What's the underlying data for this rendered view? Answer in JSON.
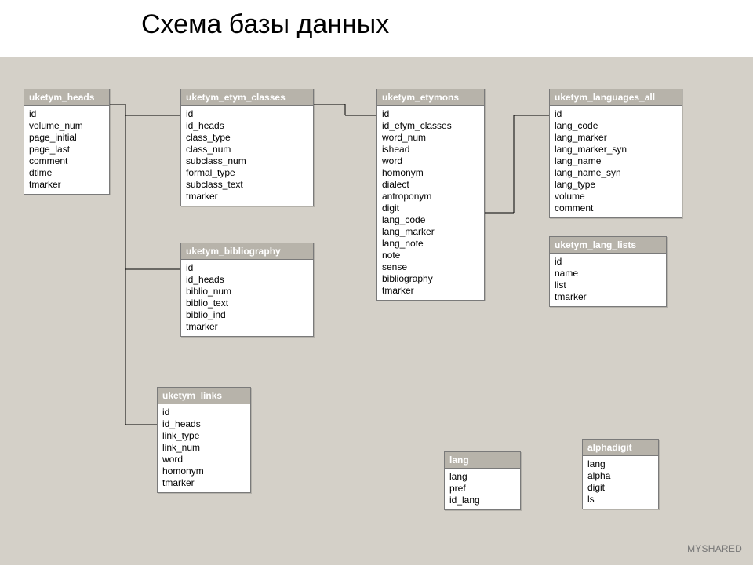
{
  "title": "Схема базы данных",
  "watermark": "MYSHARED",
  "tables": {
    "heads": {
      "name": "uketym_heads",
      "fields": [
        "id",
        "volume_num",
        "page_initial",
        "page_last",
        "comment",
        "dtime",
        "tmarker"
      ]
    },
    "etym_classes": {
      "name": "uketym_etym_classes",
      "fields": [
        "id",
        "id_heads",
        "class_type",
        "class_num",
        "subclass_num",
        "formal_type",
        "subclass_text",
        "tmarker"
      ]
    },
    "bibliography": {
      "name": "uketym_bibliography",
      "fields": [
        "id",
        "id_heads",
        "biblio_num",
        "biblio_text",
        "biblio_ind",
        "tmarker"
      ]
    },
    "links": {
      "name": "uketym_links",
      "fields": [
        "id",
        "id_heads",
        "link_type",
        "link_num",
        "word",
        "homonym",
        "tmarker"
      ]
    },
    "etymons": {
      "name": "uketym_etymons",
      "fields": [
        "id",
        "id_etym_classes",
        "word_num",
        "ishead",
        "word",
        "homonym",
        "dialect",
        "antroponym",
        "digit",
        "lang_code",
        "lang_marker",
        "lang_note",
        "note",
        "sense",
        "bibliography",
        "tmarker"
      ]
    },
    "languages_all": {
      "name": "uketym_languages_all",
      "fields": [
        "id",
        "lang_code",
        "lang_marker",
        "lang_marker_syn",
        "lang_name",
        "lang_name_syn",
        "lang_type",
        "volume",
        "comment"
      ]
    },
    "lang_lists": {
      "name": "uketym_lang_lists",
      "fields": [
        "id",
        "name",
        "list",
        "tmarker"
      ]
    },
    "lang": {
      "name": "lang",
      "fields": [
        "lang",
        "pref",
        "id_lang"
      ]
    },
    "alphadigit": {
      "name": "alphadigit",
      "fields": [
        "lang",
        "alpha",
        "digit",
        "ls"
      ]
    }
  }
}
